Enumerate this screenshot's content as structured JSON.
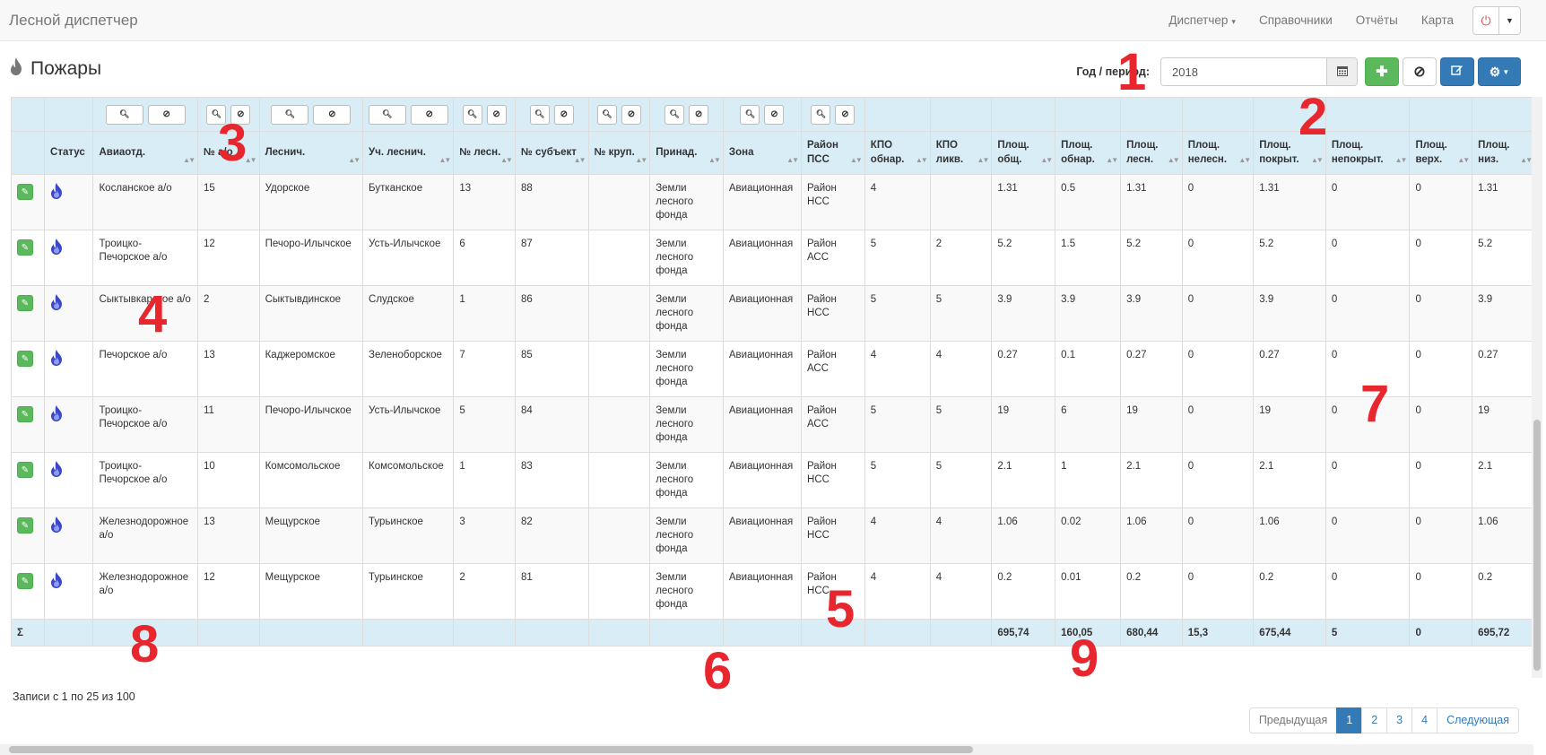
{
  "navbar": {
    "brand": "Лесной диспетчер",
    "links": [
      {
        "label": "Диспетчер",
        "dropdown": true
      },
      {
        "label": "Справочники",
        "dropdown": false
      },
      {
        "label": "Отчёты",
        "dropdown": false
      },
      {
        "label": "Карта",
        "dropdown": false
      }
    ],
    "power_icon": "power-icon"
  },
  "page": {
    "title": "Пожары",
    "title_icon": "fire-icon"
  },
  "toolbar": {
    "year_label": "Год / период:",
    "year_value": "2018",
    "calendar_icon": "calendar-icon",
    "add_icon": "plus-icon",
    "cancel_icon": "ban-icon",
    "edit_icon": "edit-icon",
    "settings_icon": "gear-icon"
  },
  "table": {
    "columns": [
      {
        "label": "",
        "filter": "none"
      },
      {
        "label": "Статус",
        "filter": "none"
      },
      {
        "label": "Авиаотд.",
        "filter": "wide"
      },
      {
        "label": "№ а/о",
        "filter": "narrow"
      },
      {
        "label": "Леснич.",
        "filter": "wide"
      },
      {
        "label": "Уч. леснич.",
        "filter": "wide"
      },
      {
        "label": "№ лесн.",
        "filter": "narrow"
      },
      {
        "label": "№ субъект",
        "filter": "narrow"
      },
      {
        "label": "№ круп.",
        "filter": "narrow"
      },
      {
        "label": "Принад.",
        "filter": "narrow"
      },
      {
        "label": "Зона",
        "filter": "narrow"
      },
      {
        "label": "Район ПСС",
        "filter": "narrow"
      },
      {
        "label": "КПО обнар.",
        "filter": "none"
      },
      {
        "label": "КПО ликв.",
        "filter": "none"
      },
      {
        "label": "Площ. общ.",
        "filter": "none"
      },
      {
        "label": "Площ. обнар.",
        "filter": "none"
      },
      {
        "label": "Площ. лесн.",
        "filter": "none"
      },
      {
        "label": "Площ. нелесн.",
        "filter": "none"
      },
      {
        "label": "Площ. покрыт.",
        "filter": "none"
      },
      {
        "label": "Площ. непокрыт.",
        "filter": "none"
      },
      {
        "label": "Площ. верх.",
        "filter": "none"
      },
      {
        "label": "Площ. низ.",
        "filter": "none"
      }
    ],
    "rows": [
      [
        "Косланское а/о",
        "15",
        "Удорское",
        "Бутканское",
        "13",
        "88",
        "",
        "Земли лесного фонда",
        "Авиационная",
        "Район НСС",
        "4",
        "",
        "1.31",
        "0.5",
        "1.31",
        "0",
        "1.31",
        "0",
        "0",
        "1.31"
      ],
      [
        "Троицко-Печорское а/о",
        "12",
        "Печоро-Илычское",
        "Усть-Илычское",
        "6",
        "87",
        "",
        "Земли лесного фонда",
        "Авиационная",
        "Район АСС",
        "5",
        "2",
        "5.2",
        "1.5",
        "5.2",
        "0",
        "5.2",
        "0",
        "0",
        "5.2"
      ],
      [
        "Сыктывкарское а/о",
        "2",
        "Сыктывдинское",
        "Слудское",
        "1",
        "86",
        "",
        "Земли лесного фонда",
        "Авиационная",
        "Район НСС",
        "5",
        "5",
        "3.9",
        "3.9",
        "3.9",
        "0",
        "3.9",
        "0",
        "0",
        "3.9"
      ],
      [
        "Печорское а/о",
        "13",
        "Каджеромское",
        "Зеленоборское",
        "7",
        "85",
        "",
        "Земли лесного фонда",
        "Авиационная",
        "Район АСС",
        "4",
        "4",
        "0.27",
        "0.1",
        "0.27",
        "0",
        "0.27",
        "0",
        "0",
        "0.27"
      ],
      [
        "Троицко-Печорское а/о",
        "11",
        "Печоро-Илычское",
        "Усть-Илычское",
        "5",
        "84",
        "",
        "Земли лесного фонда",
        "Авиационная",
        "Район АСС",
        "5",
        "5",
        "19",
        "6",
        "19",
        "0",
        "19",
        "0",
        "0",
        "19"
      ],
      [
        "Троицко-Печорское а/о",
        "10",
        "Комсомольское",
        "Комсомольское",
        "1",
        "83",
        "",
        "Земли лесного фонда",
        "Авиационная",
        "Район НСС",
        "5",
        "5",
        "2.1",
        "1",
        "2.1",
        "0",
        "2.1",
        "0",
        "0",
        "2.1"
      ],
      [
        "Железнодорожное а/о",
        "13",
        "Мещурское",
        "Турьинское",
        "3",
        "82",
        "",
        "Земли лесного фонда",
        "Авиационная",
        "Район НСС",
        "4",
        "4",
        "1.06",
        "0.02",
        "1.06",
        "0",
        "1.06",
        "0",
        "0",
        "1.06"
      ],
      [
        "Железнодорожное а/о",
        "12",
        "Мещурское",
        "Турьинское",
        "2",
        "81",
        "",
        "Земли лесного фонда",
        "Авиационная",
        "Район НСС",
        "4",
        "4",
        "0.2",
        "0.01",
        "0.2",
        "0",
        "0.2",
        "0",
        "0",
        "0.2"
      ]
    ],
    "totals": {
      "label": "Σ",
      "values": [
        "695,74",
        "160,05",
        "680,44",
        "15,3",
        "675,44",
        "5",
        "0",
        "695,72"
      ]
    },
    "row_edit_icon": "pencil-icon",
    "row_status_icon": "fire-status-icon"
  },
  "footer": {
    "records_info": "Записи с 1 по 25 из 100",
    "pagination": {
      "prev": "Предыдущая",
      "pages": [
        "1",
        "2",
        "3",
        "4"
      ],
      "active_page": "1",
      "next": "Следующая"
    }
  },
  "annotations": [
    "1",
    "2",
    "3",
    "4",
    "5",
    "6",
    "7",
    "8",
    "9"
  ],
  "colors": {
    "accent": "#337ab7",
    "success": "#5cb85c",
    "table_header_bg": "#d9edf7",
    "annotation": "#e8262d",
    "status_icon": "#3a47c9"
  }
}
